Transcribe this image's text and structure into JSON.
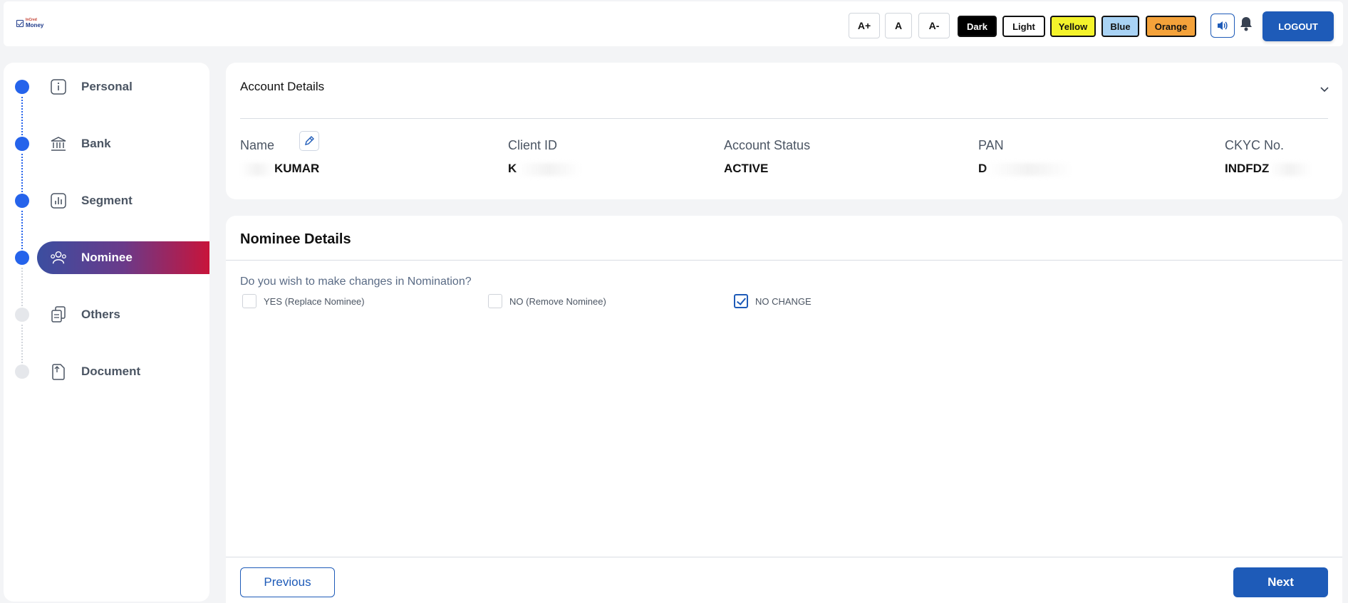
{
  "header": {
    "logo": {
      "line1": "InCred",
      "line2": "Money"
    },
    "font_buttons": [
      "A+",
      "A",
      "A-"
    ],
    "themes": [
      {
        "label": "Dark",
        "bg": "#000000",
        "fg": "#ffffff"
      },
      {
        "label": "Light",
        "bg": "#ffffff",
        "fg": "#111111"
      },
      {
        "label": "Yellow",
        "bg": "#f4f32b",
        "fg": "#111111"
      },
      {
        "label": "Blue",
        "bg": "#a9d3f5",
        "fg": "#111111"
      },
      {
        "label": "Orange",
        "bg": "#f4a23a",
        "fg": "#111111"
      }
    ],
    "speaker_icon": "speaker-icon",
    "bell_icon": "bell-icon",
    "logout_label": "LOGOUT"
  },
  "sidebar": {
    "steps": [
      {
        "label": "Personal",
        "icon": "info-icon",
        "state": "done"
      },
      {
        "label": "Bank",
        "icon": "bank-icon",
        "state": "done"
      },
      {
        "label": "Segment",
        "icon": "chart-icon",
        "state": "done"
      },
      {
        "label": "Nominee",
        "icon": "users-icon",
        "state": "active"
      },
      {
        "label": "Others",
        "icon": "documents-icon",
        "state": "pending"
      },
      {
        "label": "Document",
        "icon": "file-upload-icon",
        "state": "pending"
      }
    ]
  },
  "account": {
    "title": "Account Details",
    "fields": [
      {
        "label": "Name",
        "value": "KUMAR"
      },
      {
        "label": "Client ID",
        "value": "K"
      },
      {
        "label": "Account Status",
        "value": "ACTIVE"
      },
      {
        "label": "PAN",
        "value": "D"
      },
      {
        "label": "CKYC No.",
        "value": "INDFDZ"
      }
    ]
  },
  "nominee": {
    "title": "Nominee Details",
    "question": "Do you wish to make changes in Nomination?",
    "options": [
      {
        "label": "YES (Replace Nominee)",
        "checked": false
      },
      {
        "label": "NO (Remove Nominee)",
        "checked": false
      },
      {
        "label": "NO CHANGE",
        "checked": true
      }
    ],
    "previous_label": "Previous",
    "next_label": "Next"
  },
  "colors": {
    "primary": "#1e5bb8",
    "step_done": "#2563eb",
    "step_pending": "#e5e7eb"
  }
}
